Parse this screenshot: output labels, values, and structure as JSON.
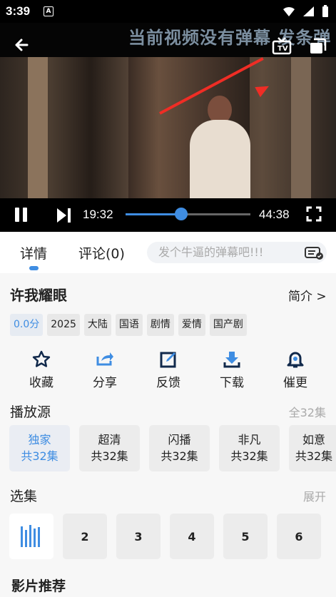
{
  "status": {
    "time": "3:39",
    "notification_letter": "A"
  },
  "player": {
    "danmaku_text": "当前视频没有弹幕 发条弹",
    "current_time": "19:32",
    "total_time": "44:38",
    "progress": 0.444
  },
  "tabs": {
    "details": "详情",
    "comments": "评论(0)"
  },
  "danmaku_input": {
    "placeholder": "发个牛逼的弹幕吧!!!"
  },
  "show": {
    "title": "许我耀眼",
    "summary_link": "简介 >",
    "tags": [
      "0.0分",
      "2025",
      "大陆",
      "国语",
      "剧情",
      "爱情",
      "国产剧"
    ]
  },
  "actions": {
    "favorite": "收藏",
    "share": "分享",
    "feedback": "反馈",
    "download": "下载",
    "remind": "催更"
  },
  "sources": {
    "heading": "播放源",
    "total": "全32集",
    "items": [
      {
        "name": "独家",
        "count": "共32集"
      },
      {
        "name": "超清",
        "count": "共32集"
      },
      {
        "name": "闪播",
        "count": "共32集"
      },
      {
        "name": "非凡",
        "count": "共32集"
      },
      {
        "name": "如意",
        "count": "共32集"
      }
    ]
  },
  "episodes": {
    "heading": "选集",
    "expand": "展开",
    "items": [
      "2",
      "3",
      "4",
      "5",
      "6"
    ]
  },
  "recommend": {
    "heading": "影片推荐"
  },
  "colors": {
    "accent": "#3f8de2",
    "annotation": "#ef2d25"
  }
}
